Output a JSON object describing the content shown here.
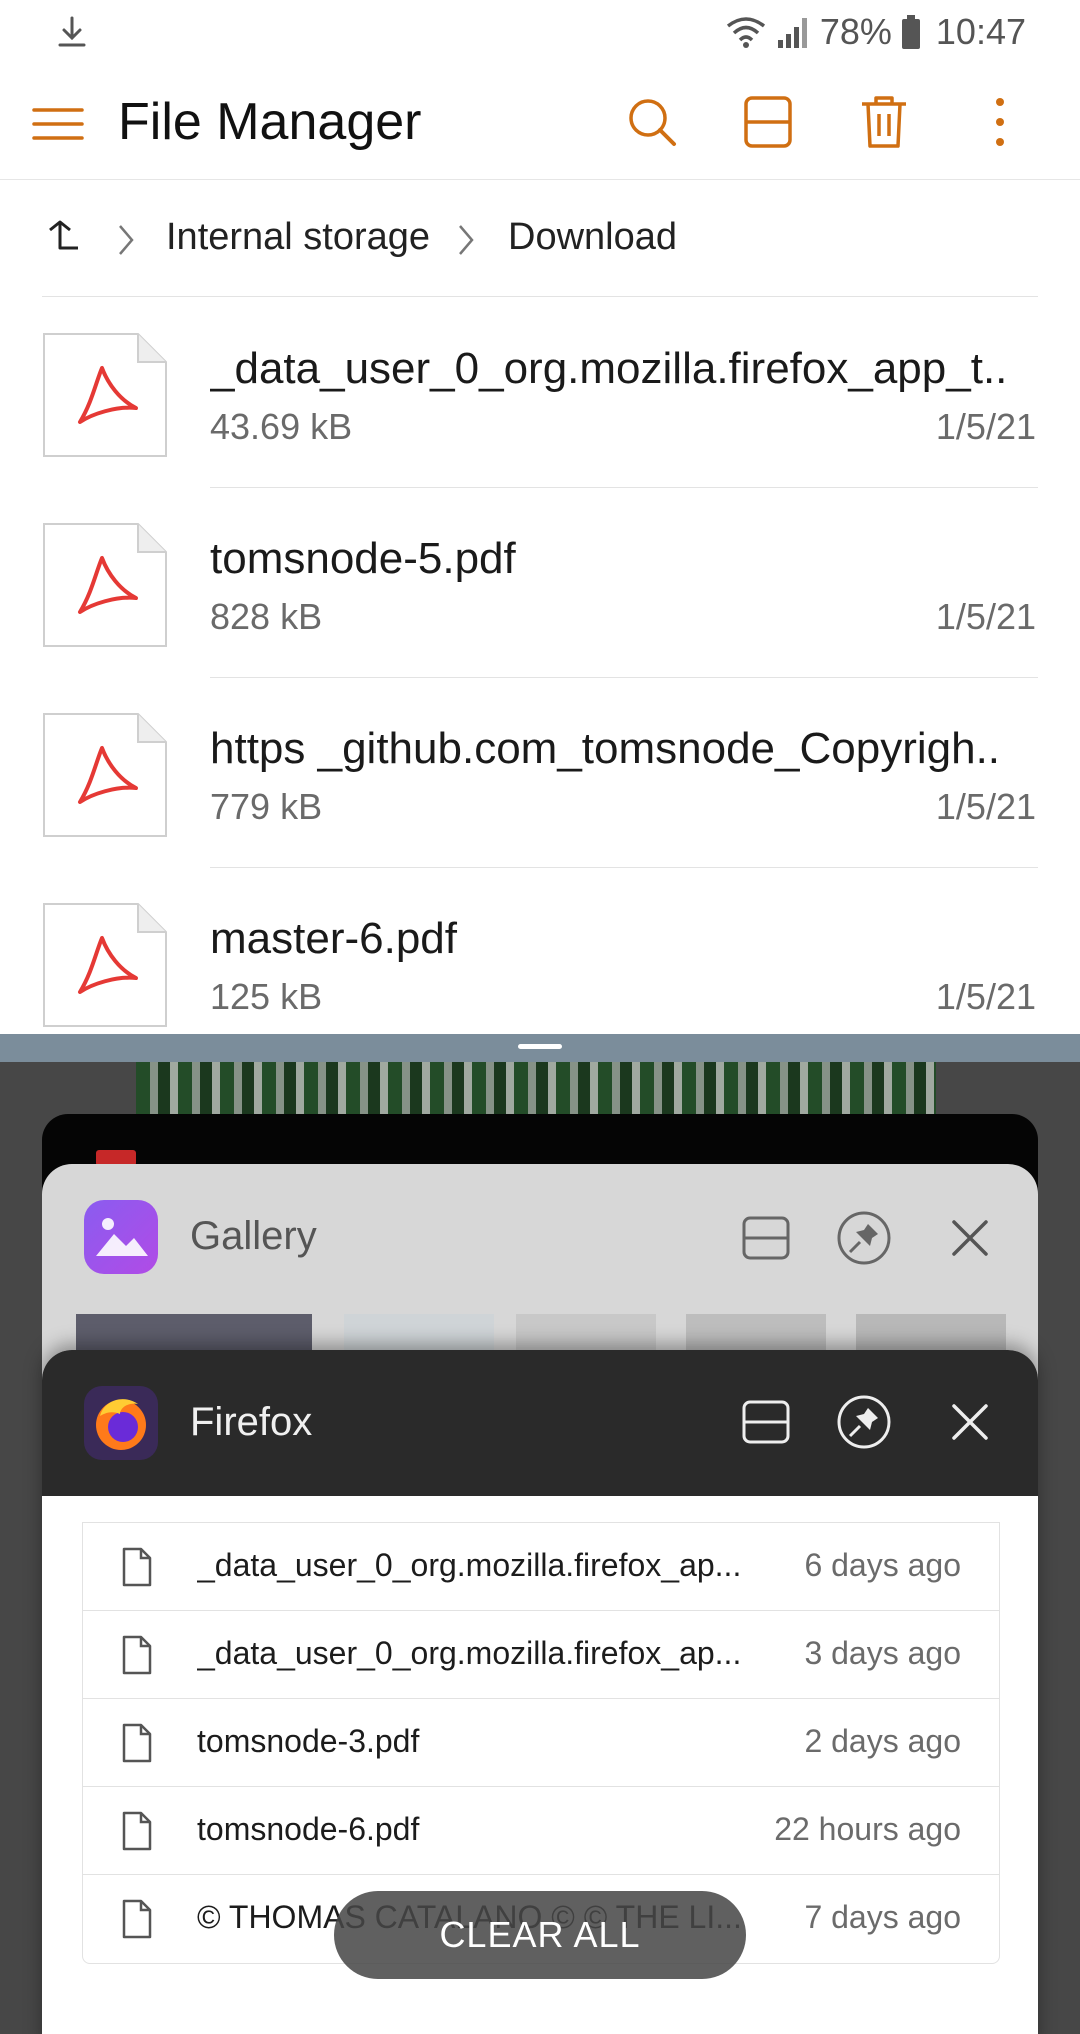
{
  "status_bar": {
    "battery_percent": "78%",
    "time": "10:47"
  },
  "app": {
    "title": "File Manager",
    "accent_color": "#d06f12"
  },
  "breadcrumb": {
    "items": [
      "Internal storage",
      "Download"
    ]
  },
  "files": [
    {
      "name": "_data_user_0_org.mozilla.firefox_app_t..",
      "size": "43.69 kB",
      "date": "1/5/21"
    },
    {
      "name": "tomsnode-5.pdf",
      "size": "828 kB",
      "date": "1/5/21"
    },
    {
      "name": "https _github.com_tomsnode_Copyrigh..",
      "size": "779 kB",
      "date": "1/5/21"
    },
    {
      "name": "master-6.pdf",
      "size": "125 kB",
      "date": "1/5/21"
    }
  ],
  "recents": {
    "gallery": {
      "title": "Gallery"
    },
    "firefox": {
      "title": "Firefox",
      "downloads": [
        {
          "name": "_data_user_0_org.mozilla.firefox_ap...",
          "time": "6 days ago"
        },
        {
          "name": "_data_user_0_org.mozilla.firefox_ap...",
          "time": "3 days ago"
        },
        {
          "name": "tomsnode-3.pdf",
          "time": "2 days ago"
        },
        {
          "name": "tomsnode-6.pdf",
          "time": "22 hours ago"
        },
        {
          "name": "© THOMAS CATALANO © © THE LI...",
          "time": "7 days ago"
        }
      ]
    },
    "clear_all_label": "CLEAR ALL"
  }
}
